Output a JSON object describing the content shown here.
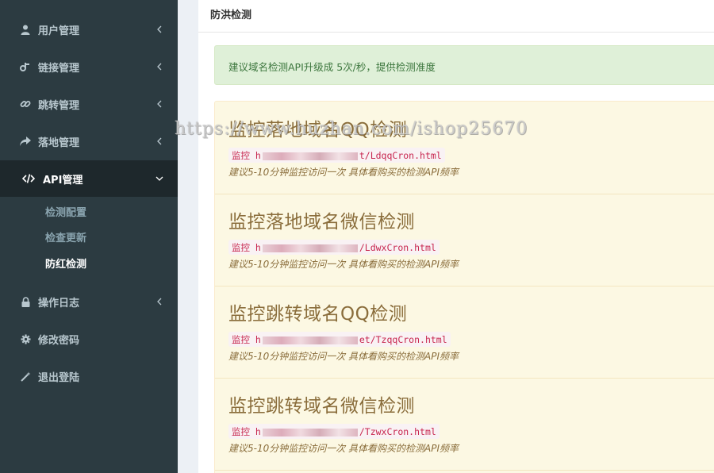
{
  "sidebar": {
    "items": [
      {
        "label": "用户管理",
        "icon": "user-icon"
      },
      {
        "label": "链接管理",
        "icon": "link-tree-icon"
      },
      {
        "label": "跳转管理",
        "icon": "chain-link-icon"
      },
      {
        "label": "落地管理",
        "icon": "share-arrow-icon"
      },
      {
        "label": "API管理",
        "icon": "code-icon"
      },
      {
        "label": "操作日志",
        "icon": "lock-icon"
      },
      {
        "label": "修改密码",
        "icon": "gear-icon"
      },
      {
        "label": "退出登陆",
        "icon": "magic-wand-icon"
      }
    ],
    "sub_items": [
      {
        "label": "检测配置"
      },
      {
        "label": "检查更新"
      },
      {
        "label": "防红检测",
        "active": true
      }
    ]
  },
  "main": {
    "title": "防洪检测",
    "alert": "建议域名检测API升级成 5次/秒，提供检测准度",
    "sections": [
      {
        "heading": "监控落地域名QQ检测",
        "url_prefix": "监控 h",
        "url_suffix": "t/LdqqCron.html",
        "note": "建议5-10分钟监控访问一次 具体看购买的检测API频率"
      },
      {
        "heading": "监控落地域名微信检测",
        "url_prefix": "监控 h",
        "url_suffix": "/LdwxCron.html",
        "note": "建议5-10分钟监控访问一次 具体看购买的检测API频率"
      },
      {
        "heading": "监控跳转域名QQ检测",
        "url_prefix": "监控 h",
        "url_suffix": "et/TzqqCron.html",
        "note": "建议5-10分钟监控访问一次 具体看购买的检测API频率"
      },
      {
        "heading": "监控跳转域名微信检测",
        "url_prefix": "监控 h",
        "url_suffix": "/TzwxCron.html",
        "note": "建议5-10分钟监控访问一次 具体看购买的检测API频率"
      }
    ]
  },
  "watermark": "https://www.huzhan.com/ishop25670",
  "colors": {
    "sidebar_bg": "#2c3b41",
    "accent": "#3c8dbc",
    "alert_bg": "#dff0d8",
    "panel_bg": "#fcf8e3",
    "code_color": "#c7254e"
  }
}
